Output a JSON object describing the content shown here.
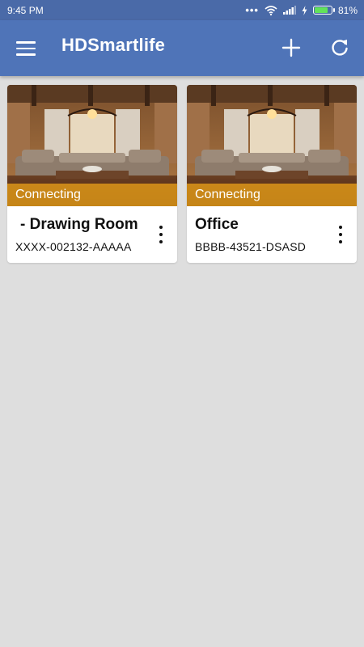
{
  "status_bar": {
    "time": "9:45 PM",
    "battery": "81%",
    "battery_level": 0.81
  },
  "app_bar": {
    "title": "HDSmartlife"
  },
  "colors": {
    "app_bar": "#4f74b8",
    "status_bar": "#4a6aa8",
    "connecting_strip": "#dd9619",
    "background": "#dedede"
  },
  "devices": [
    {
      "name": "- Drawing Room",
      "id": "XXXX-002132-AAAAA",
      "status": "Connecting",
      "icon": "more-vert-icon"
    },
    {
      "name": "Office",
      "id": "BBBB-43521-DSASD",
      "status": "Connecting",
      "icon": "more-vert-icon"
    }
  ]
}
